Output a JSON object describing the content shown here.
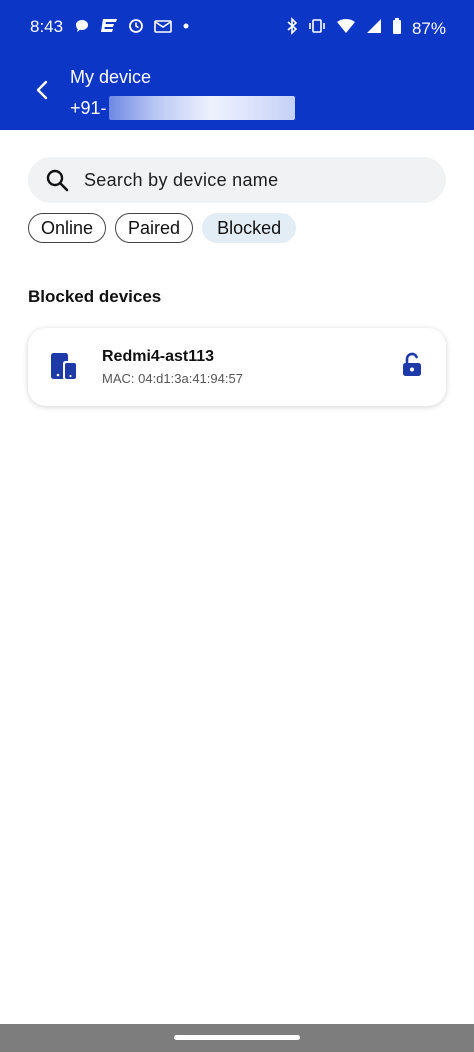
{
  "status_bar": {
    "time": "8:43",
    "battery": "87%",
    "left_icons": [
      "chat-icon",
      "app-e-icon",
      "clock-sync-icon",
      "outlook-icon",
      "dot-icon"
    ],
    "right_icons": [
      "bluetooth-icon",
      "vibrate-icon",
      "wifi-icon",
      "signal-icon",
      "battery-icon"
    ]
  },
  "header": {
    "title": "My device",
    "subtitle": "+91-"
  },
  "search": {
    "placeholder": "Search by device name"
  },
  "filters": {
    "chips": [
      "Online",
      "Paired",
      "Blocked"
    ],
    "selected": "Blocked"
  },
  "section": {
    "title": "Blocked devices"
  },
  "devices": [
    {
      "name": "Redmi4-ast113",
      "mac": "MAC: 04:d1:3a:41:94:57",
      "icon": "devices-icon",
      "action_icon": "unlock-icon"
    }
  ],
  "colors": {
    "brand": "#0c36c6",
    "icon_blue": "#1e3aa8",
    "chip_selected_bg": "#e3edf6",
    "search_bg": "#f1f2f4"
  }
}
